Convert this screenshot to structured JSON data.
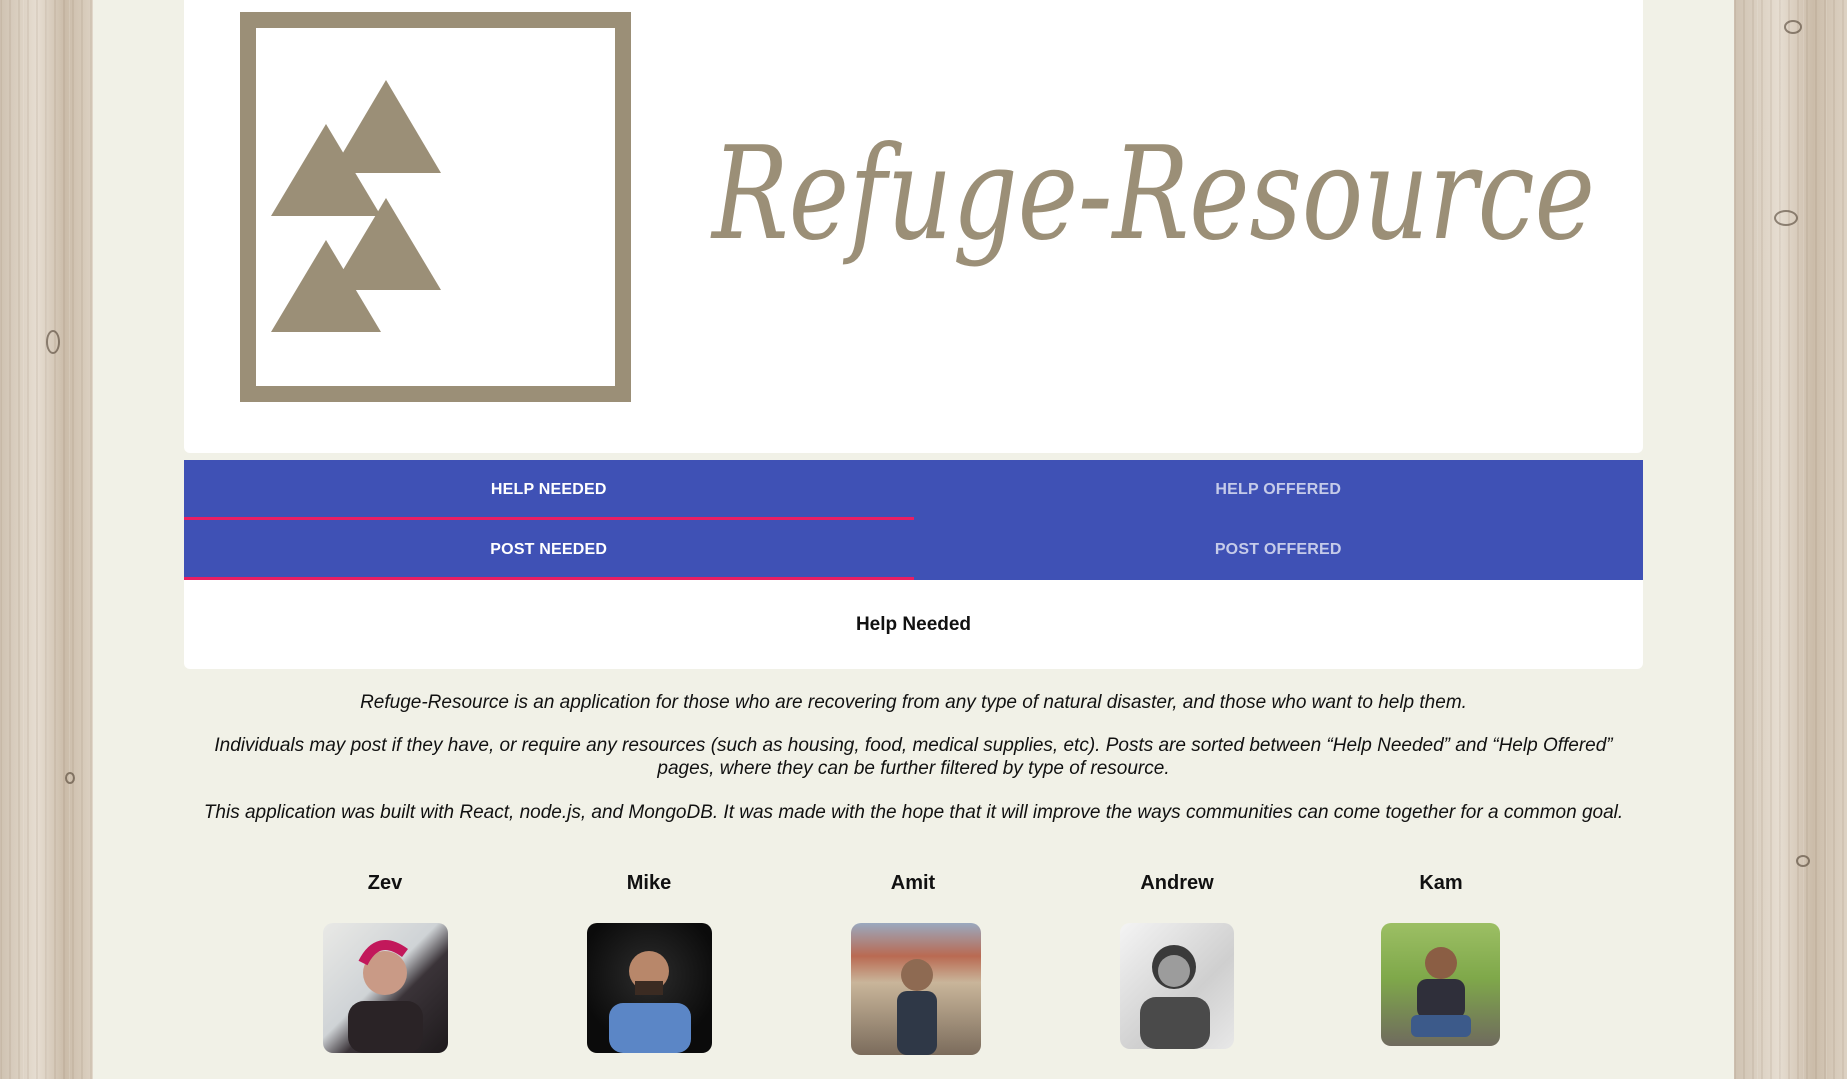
{
  "brand": {
    "name": "Refuge-Resource",
    "color": "#9b8f77"
  },
  "tabs_row1": [
    {
      "label": "HELP NEEDED",
      "active": true
    },
    {
      "label": "HELP OFFERED",
      "active": false
    }
  ],
  "tabs_row2": [
    {
      "label": "POST NEEDED",
      "active": true
    },
    {
      "label": "POST OFFERED",
      "active": false
    }
  ],
  "content": {
    "heading": "Help Needed"
  },
  "about": {
    "p1": "Refuge-Resource is an application for those who are recovering from any type of natural disaster, and those who want to help them.",
    "p2": "Individuals may post if they have, or require any resources (such as housing, food, medical supplies, etc). Posts are sorted between “Help Needed” and “Help Offered” pages, where they can be further filtered by type of resource.",
    "p3": "This application was built with React, node.js, and MongoDB. It was made with the hope that it will improve the ways communities can come together for a common goal."
  },
  "team": [
    {
      "name": "Zev"
    },
    {
      "name": "Mike"
    },
    {
      "name": "Amit"
    },
    {
      "name": "Andrew"
    },
    {
      "name": "Kam"
    }
  ],
  "colors": {
    "appbar": "#3f51b5",
    "indicator": "#e91e63"
  }
}
